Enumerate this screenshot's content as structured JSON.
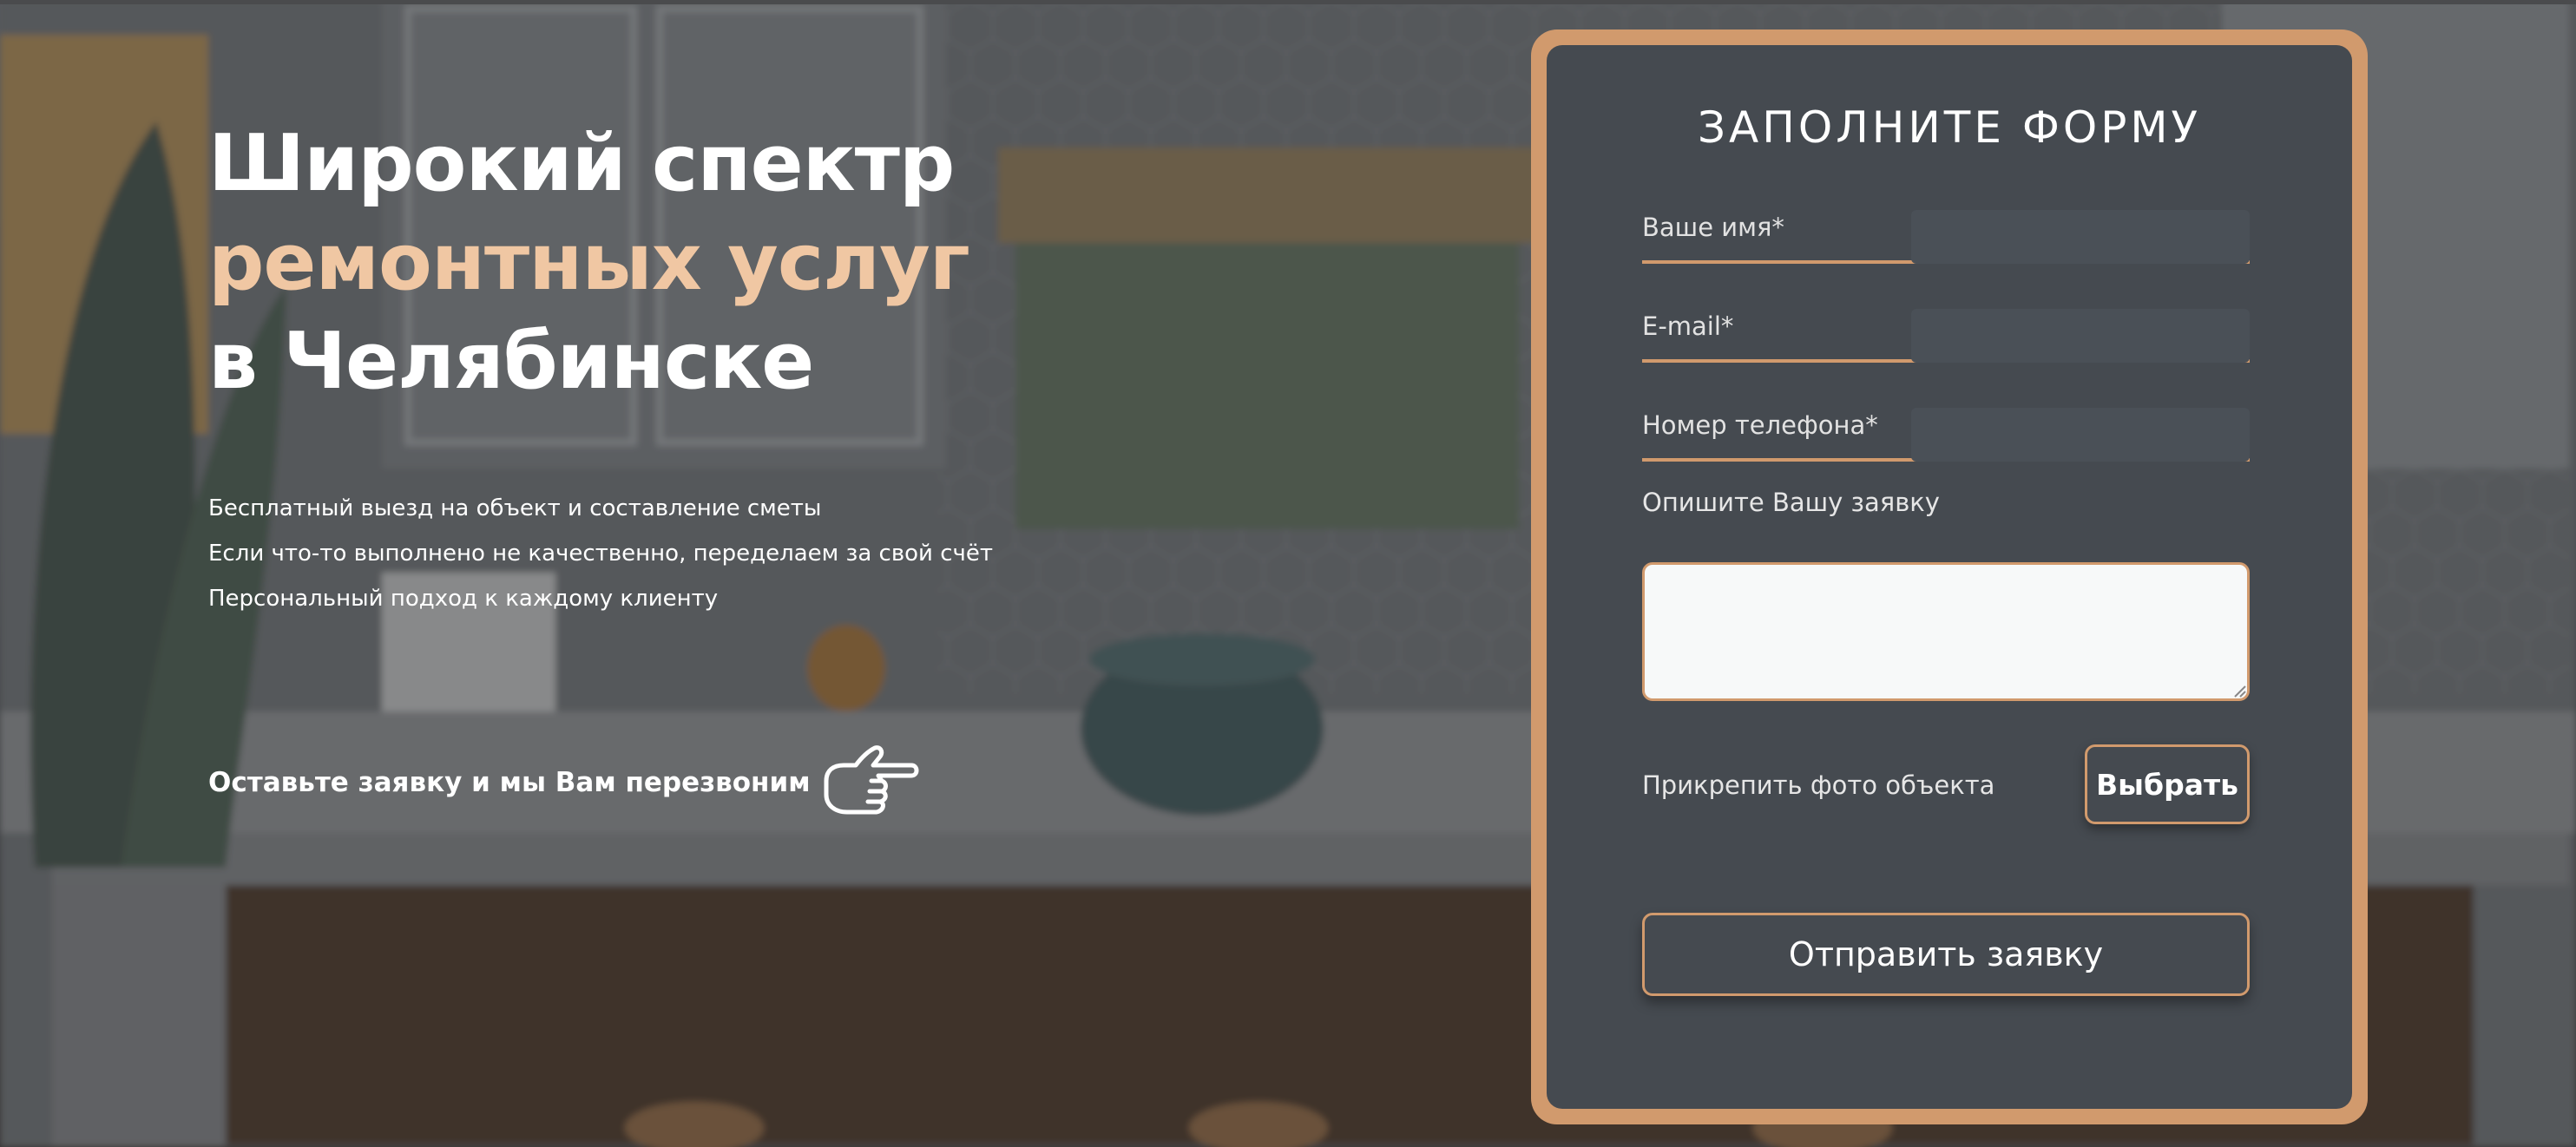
{
  "colors": {
    "accent": "#d19a6d",
    "headline_accent": "#f0c7a3",
    "form_bg": "#454a50",
    "text": "#ffffff"
  },
  "hero": {
    "headline_line1": "Широкий спектр",
    "headline_line2": "ремонтных услуг",
    "headline_line3": "в Челябинске",
    "benefits": [
      "Бесплатный выезд на объект и составление сметы",
      "Если что-то выполнено не качественно, переделаем за свой счёт",
      "Персональный подход к каждому клиенту"
    ],
    "cta_text": "Оставьте заявку и мы Вам перезвоним",
    "cta_icon": "pointing-hand-icon"
  },
  "form": {
    "title": "ЗАПОЛНИТЕ ФОРМУ",
    "name_placeholder": "Ваше имя*",
    "email_placeholder": "E-mail*",
    "phone_placeholder": "Номер телефона*",
    "description_label": "Опишите Вашу заявку",
    "attach_label": "Прикрепить фото объекта",
    "choose_button": "Выбрать",
    "submit_button": "Отправить заявку"
  }
}
